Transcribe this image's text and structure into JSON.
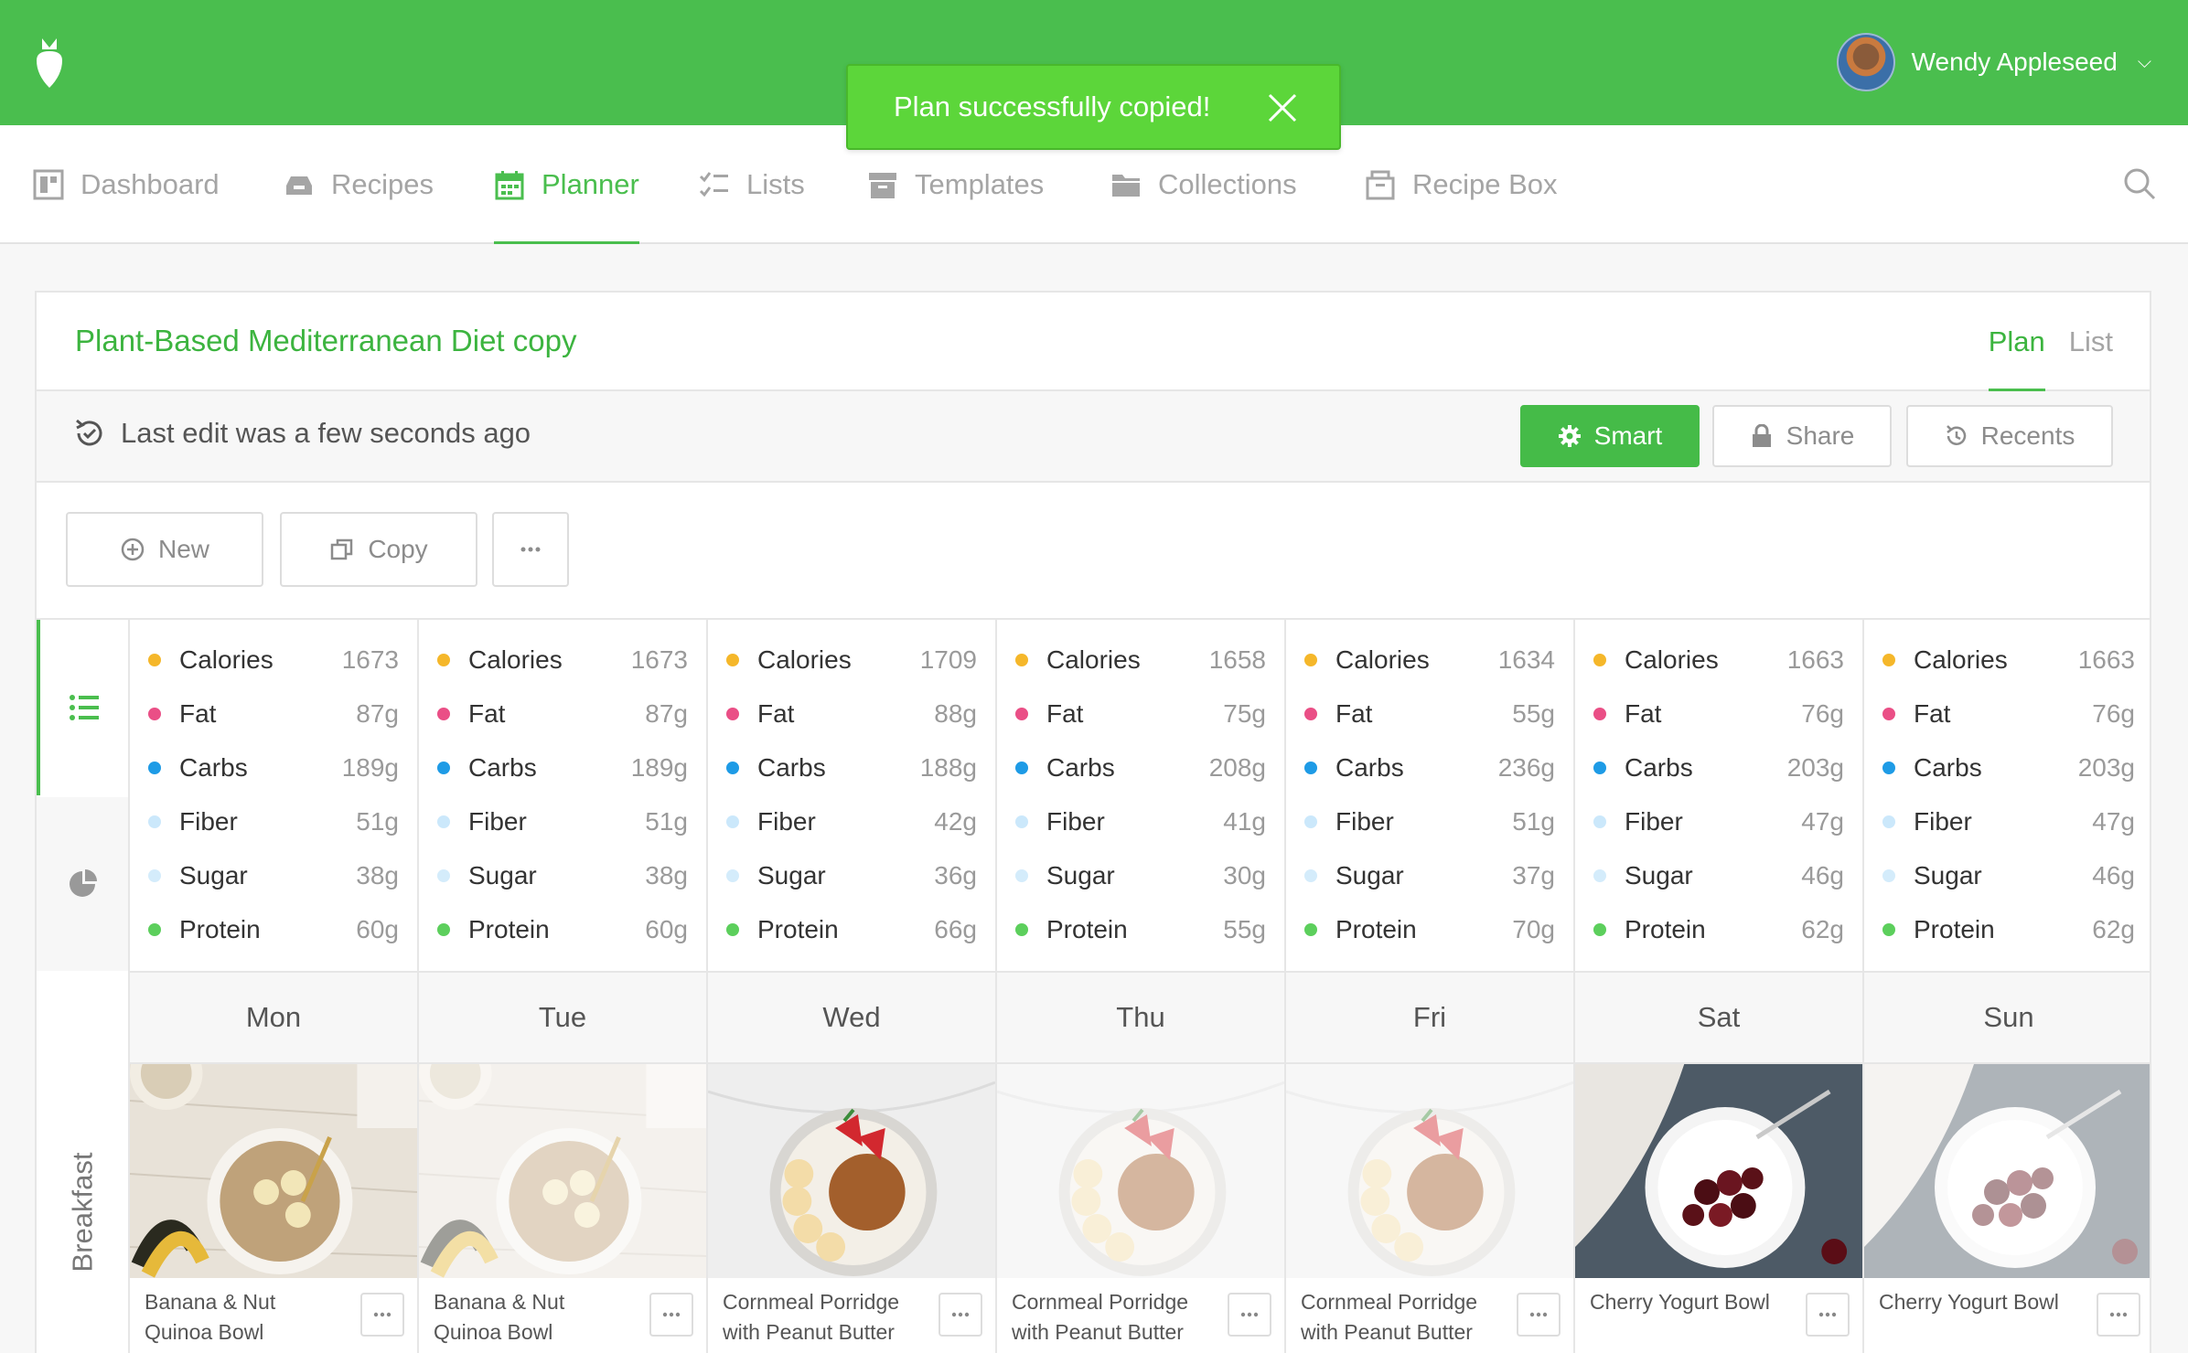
{
  "user": {
    "name": "Wendy Appleseed"
  },
  "toast": {
    "message": "Plan successfully copied!"
  },
  "nav": [
    {
      "label": "Dashboard",
      "icon": "dashboard-icon",
      "active": false
    },
    {
      "label": "Recipes",
      "icon": "tray-icon",
      "active": false
    },
    {
      "label": "Planner",
      "icon": "calendar-icon",
      "active": true
    },
    {
      "label": "Lists",
      "icon": "checklist-icon",
      "active": false
    },
    {
      "label": "Templates",
      "icon": "archive-icon",
      "active": false
    },
    {
      "label": "Collections",
      "icon": "folder-icon",
      "active": false
    },
    {
      "label": "Recipe Box",
      "icon": "box-icon",
      "active": false
    }
  ],
  "plan": {
    "title": "Plant-Based Mediterranean Diet copy",
    "view_tabs": [
      "Plan",
      "List"
    ],
    "active_view": "Plan",
    "last_edit": "Last edit was a few seconds ago",
    "smart_label": "Smart",
    "share_label": "Share",
    "recents_label": "Recents",
    "new_label": "New",
    "copy_label": "Copy",
    "meal_section": "Breakfast"
  },
  "colors": {
    "brand": "#4abe4e",
    "toast": "#5cd63a",
    "calories": "#f5b72a",
    "fat": "#ea4f86",
    "carbs": "#1e9be6",
    "fiber": "#cbe8fb",
    "sugar": "#d4ecfb",
    "protein": "#5ccf5c"
  },
  "nutrient_names": [
    "Calories",
    "Fat",
    "Carbs",
    "Fiber",
    "Sugar",
    "Protein"
  ],
  "days": [
    {
      "name": "Mon",
      "values": [
        "1673",
        "87g",
        "189g",
        "51g",
        "38g",
        "60g"
      ],
      "meal": "Banana & Nut Quinoa Bowl",
      "faded": false
    },
    {
      "name": "Tue",
      "values": [
        "1673",
        "87g",
        "189g",
        "51g",
        "38g",
        "60g"
      ],
      "meal": "Banana & Nut Quinoa Bowl",
      "faded": true
    },
    {
      "name": "Wed",
      "values": [
        "1709",
        "88g",
        "188g",
        "42g",
        "36g",
        "66g"
      ],
      "meal": "Cornmeal Porridge with Peanut Butter",
      "faded": false
    },
    {
      "name": "Thu",
      "values": [
        "1658",
        "75g",
        "208g",
        "41g",
        "30g",
        "55g"
      ],
      "meal": "Cornmeal Porridge with Peanut Butter",
      "faded": true
    },
    {
      "name": "Fri",
      "values": [
        "1634",
        "55g",
        "236g",
        "51g",
        "37g",
        "70g"
      ],
      "meal": "Cornmeal Porridge with Peanut Butter",
      "faded": true
    },
    {
      "name": "Sat",
      "values": [
        "1663",
        "76g",
        "203g",
        "47g",
        "46g",
        "62g"
      ],
      "meal": "Cherry Yogurt Bowl",
      "faded": false
    },
    {
      "name": "Sun",
      "values": [
        "1663",
        "76g",
        "203g",
        "47g",
        "46g",
        "62g"
      ],
      "meal": "Cherry Yogurt Bowl",
      "faded": true
    }
  ]
}
